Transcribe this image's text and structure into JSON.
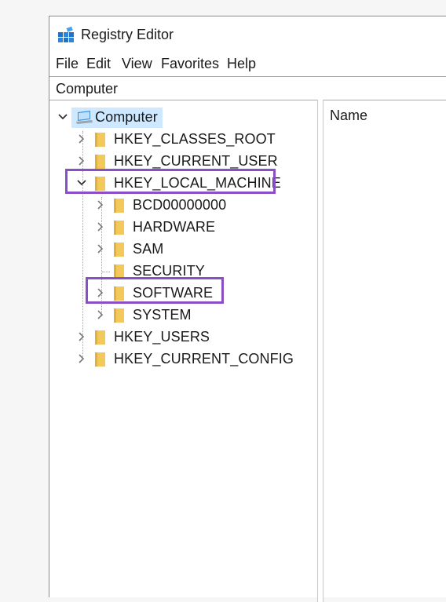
{
  "window": {
    "title": "Registry Editor"
  },
  "menu": {
    "items": [
      "File",
      "Edit",
      "View",
      "Favorites",
      "Help"
    ]
  },
  "address": {
    "path": "Computer"
  },
  "list": {
    "column_name": "Name"
  },
  "tree": {
    "root": "Computer",
    "hives": {
      "classes_root": "HKEY_CLASSES_ROOT",
      "current_user": "HKEY_CURRENT_USER",
      "local_machine": "HKEY_LOCAL_MACHINE",
      "users": "HKEY_USERS",
      "current_config": "HKEY_CURRENT_CONFIG"
    },
    "local_machine_children": {
      "bcd": "BCD00000000",
      "hardware": "HARDWARE",
      "sam": "SAM",
      "security": "SECURITY",
      "software": "SOFTWARE",
      "system": "SYSTEM"
    }
  },
  "colors": {
    "highlight": "#8a4fc7",
    "selection": "#cde8ff",
    "folder": "#f2c95a"
  }
}
